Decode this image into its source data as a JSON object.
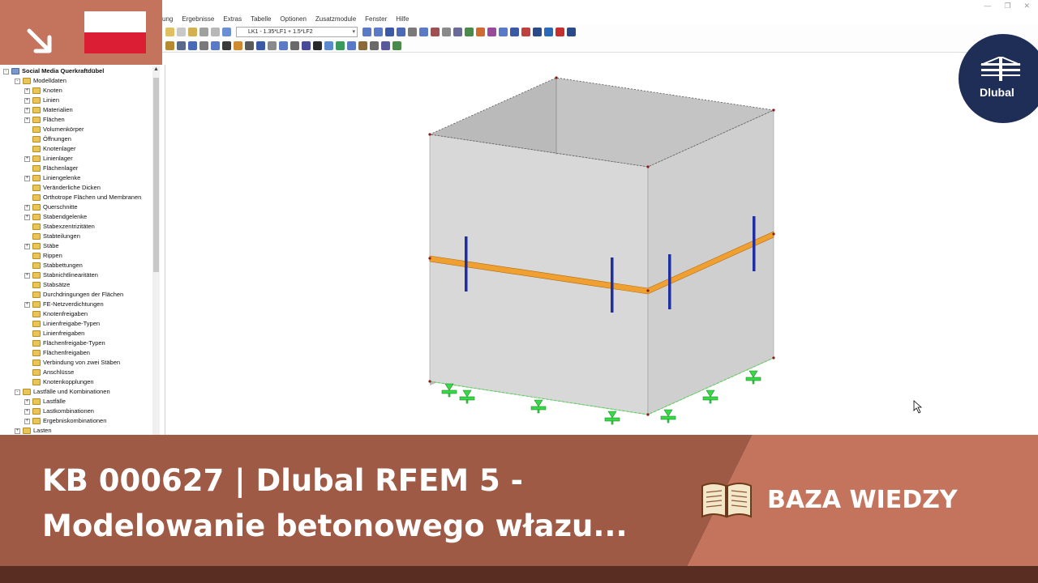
{
  "menu": {
    "items": [
      "ung",
      "Ergebnisse",
      "Extras",
      "Tabelle",
      "Optionen",
      "Zusatzmodule",
      "Fenster",
      "Hilfe"
    ]
  },
  "toolbar": {
    "load_combo_value": "LK1 - 1.35*LF1 + 1.5*LF2"
  },
  "navigator": {
    "root": "Social Media Querkraftdübel",
    "items": [
      {
        "label": "Modelldaten",
        "level": 1,
        "expander": "-"
      },
      {
        "label": "Knoten",
        "level": 2,
        "expander": "+"
      },
      {
        "label": "Linien",
        "level": 2,
        "expander": "+"
      },
      {
        "label": "Materialien",
        "level": 2,
        "expander": "+"
      },
      {
        "label": "Flächen",
        "level": 2,
        "expander": "+"
      },
      {
        "label": "Volumenkörper",
        "level": 2,
        "expander": ""
      },
      {
        "label": "Öffnungen",
        "level": 2,
        "expander": ""
      },
      {
        "label": "Knotenlager",
        "level": 2,
        "expander": ""
      },
      {
        "label": "Linienlager",
        "level": 2,
        "expander": "+"
      },
      {
        "label": "Flächenlager",
        "level": 2,
        "expander": ""
      },
      {
        "label": "Liniengelenke",
        "level": 2,
        "expander": "+"
      },
      {
        "label": "Veränderliche Dicken",
        "level": 2,
        "expander": ""
      },
      {
        "label": "Orthotrope Flächen und Membranen",
        "level": 2,
        "expander": ""
      },
      {
        "label": "Querschnitte",
        "level": 2,
        "expander": "+"
      },
      {
        "label": "Stabendgelenke",
        "level": 2,
        "expander": "+"
      },
      {
        "label": "Stabexzentrizitäten",
        "level": 2,
        "expander": ""
      },
      {
        "label": "Stabteilungen",
        "level": 2,
        "expander": ""
      },
      {
        "label": "Stäbe",
        "level": 2,
        "expander": "+"
      },
      {
        "label": "Rippen",
        "level": 2,
        "expander": ""
      },
      {
        "label": "Stabbettungen",
        "level": 2,
        "expander": ""
      },
      {
        "label": "Stabnichtlinearitäten",
        "level": 2,
        "expander": "+"
      },
      {
        "label": "Stabsätze",
        "level": 2,
        "expander": ""
      },
      {
        "label": "Durchdringungen der Flächen",
        "level": 2,
        "expander": ""
      },
      {
        "label": "FE-Netzverdichtungen",
        "level": 2,
        "expander": "+"
      },
      {
        "label": "Knotenfreigaben",
        "level": 2,
        "expander": ""
      },
      {
        "label": "Linienfreigabe-Typen",
        "level": 2,
        "expander": ""
      },
      {
        "label": "Linienfreigaben",
        "level": 2,
        "expander": ""
      },
      {
        "label": "Flächenfreigabe-Typen",
        "level": 2,
        "expander": ""
      },
      {
        "label": "Flächenfreigaben",
        "level": 2,
        "expander": ""
      },
      {
        "label": "Verbindung von zwei Stäben",
        "level": 2,
        "expander": ""
      },
      {
        "label": "Anschlüsse",
        "level": 2,
        "expander": ""
      },
      {
        "label": "Knotenkopplungen",
        "level": 2,
        "expander": ""
      },
      {
        "label": "Lastfälle und Kombinationen",
        "level": 1,
        "expander": "-"
      },
      {
        "label": "Lastfälle",
        "level": 2,
        "expander": "+"
      },
      {
        "label": "Lastkombinationen",
        "level": 2,
        "expander": "+"
      },
      {
        "label": "Ergebniskombinationen",
        "level": 2,
        "expander": "+"
      },
      {
        "label": "Lasten",
        "level": 1,
        "expander": "+"
      }
    ]
  },
  "overlay": {
    "logo_text": "Dlubal",
    "title_line1": "KB 000627 | Dlubal RFEM 5 -",
    "title_line2": "Modelowanie betonowego włazu...",
    "category_label": "BAZA WIEDZY",
    "flag": "poland-flag-icon"
  },
  "colors": {
    "banner_dark": "#9e5a45",
    "banner_light": "#c4735c",
    "footer": "#5a2d22",
    "logo_bg": "#1f2e57",
    "beam": "#f0a030",
    "dowel": "#1f2fa0",
    "support": "#38d848"
  }
}
